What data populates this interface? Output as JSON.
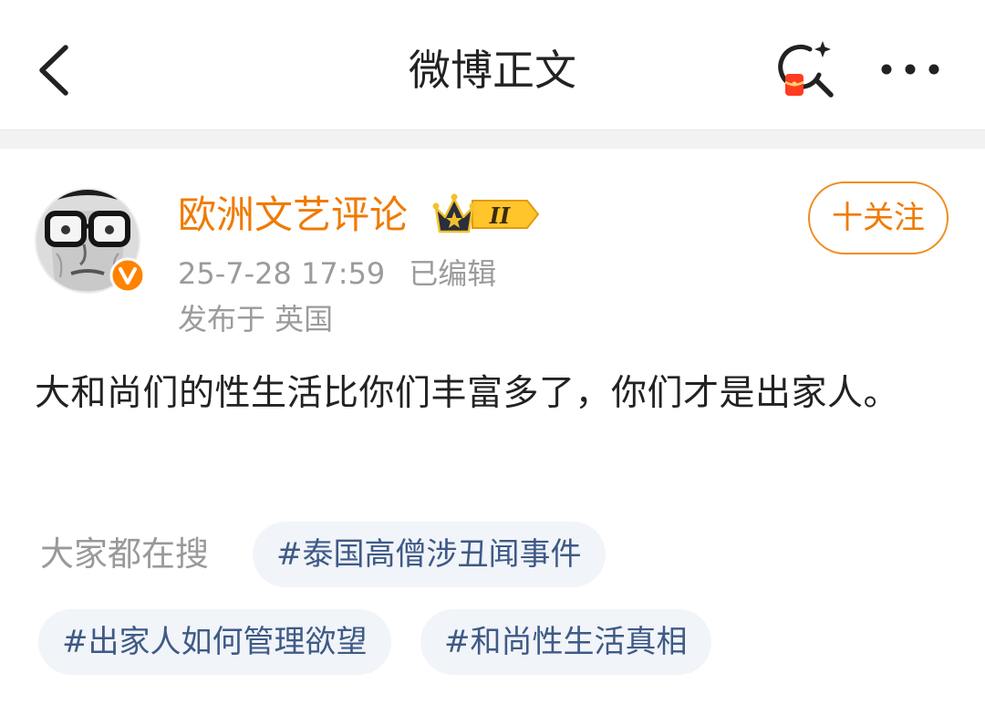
{
  "header": {
    "title": "微博正文",
    "back_icon": "chevron-left-icon",
    "search_icon": "search-sparkle-icon",
    "more_icon": "more-dots-icon"
  },
  "post": {
    "author": {
      "name": "欧洲文艺评论",
      "level_badge": "II",
      "verified_icon": "v-verified-icon"
    },
    "timestamp": "25-7-28 17:59",
    "edited_label": "已编辑",
    "location": "发布于 英国",
    "follow_label": "十关注",
    "content": "大和尚们的性生活比你们丰富多了，你们才是出家人。"
  },
  "search_section": {
    "label": "大家都在搜",
    "tags": [
      "#泰国高僧涉丑闻事件",
      "#出家人如何管理欲望",
      "#和尚性生活真相"
    ]
  },
  "colors": {
    "accent_orange": "#f07a00",
    "tag_text": "#3e5a86",
    "tag_bg": "#f1f4f8",
    "muted_text": "#9b9b9b"
  }
}
